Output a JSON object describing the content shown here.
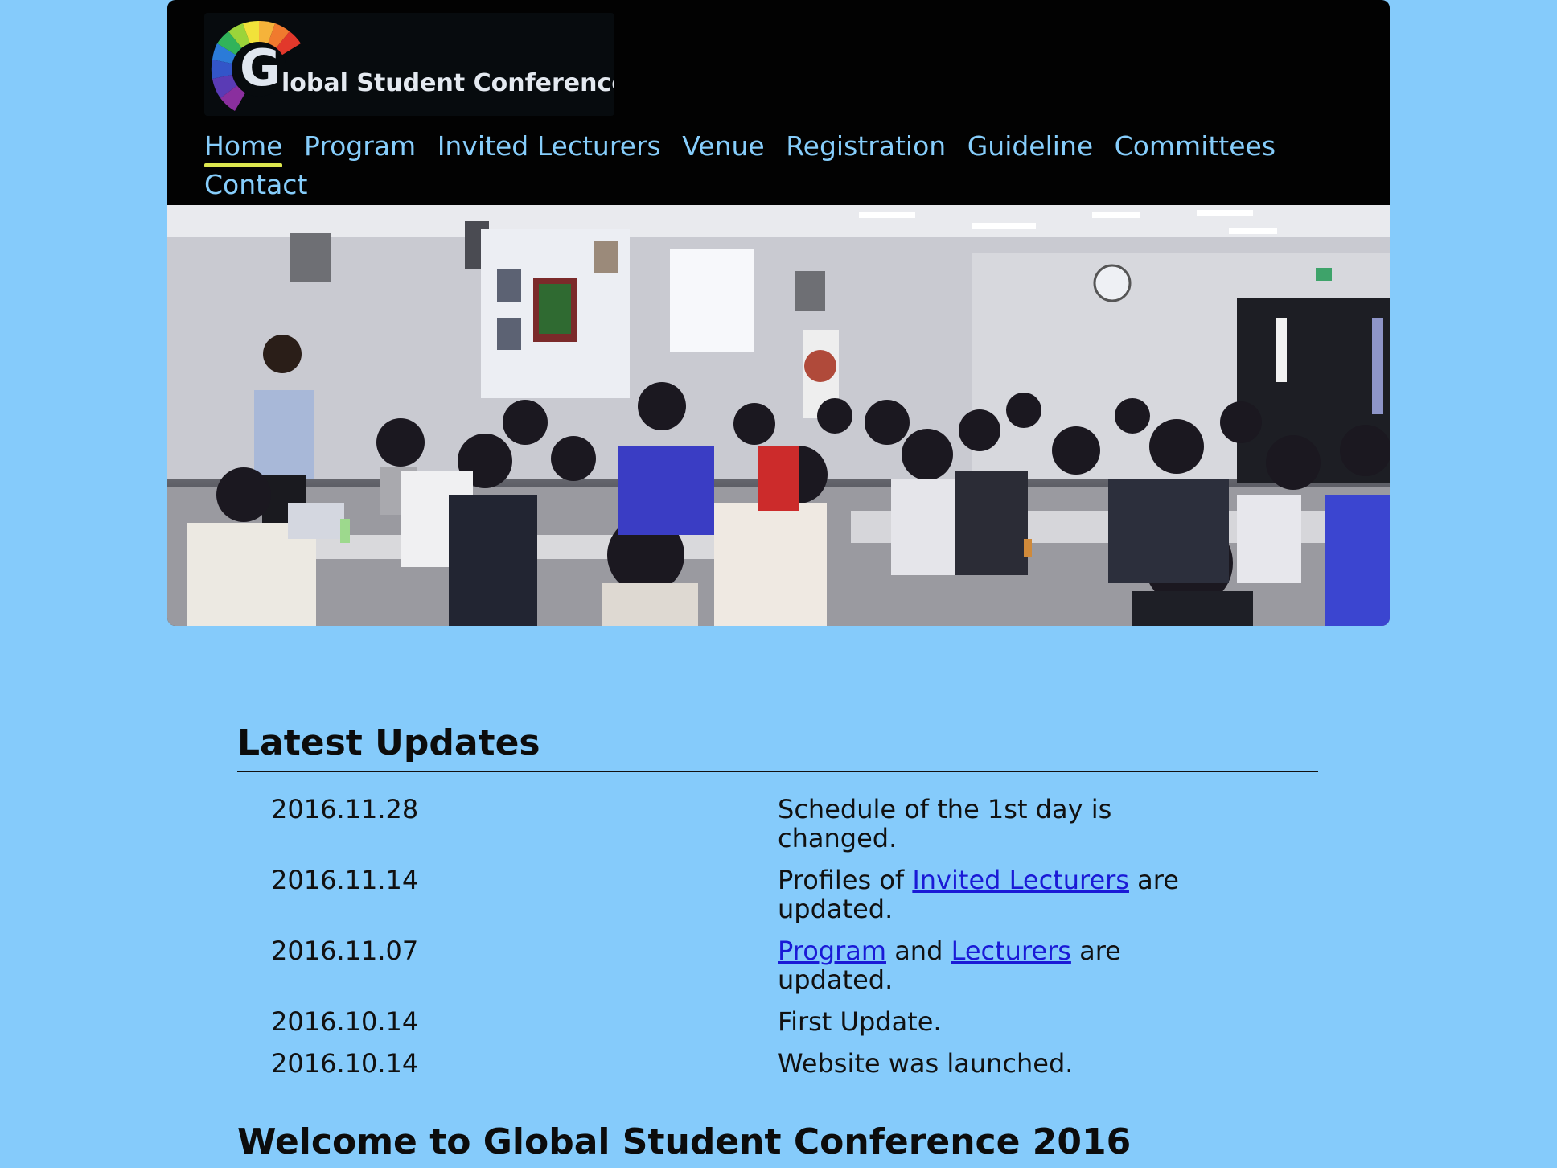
{
  "header": {
    "logo_letter": "G",
    "logo_text": "lobal Student Conference",
    "nav": [
      {
        "label": "Home",
        "active": true
      },
      {
        "label": "Program",
        "active": false
      },
      {
        "label": "Invited Lecturers",
        "active": false
      },
      {
        "label": "Venue",
        "active": false
      },
      {
        "label": "Registration",
        "active": false
      },
      {
        "label": "Guideline",
        "active": false
      },
      {
        "label": "Committees",
        "active": false
      },
      {
        "label": "Contact",
        "active": false
      }
    ]
  },
  "updates": {
    "title": "Latest Updates",
    "rows": [
      {
        "date": "2016.11.28",
        "text": "Schedule of the 1st day is changed."
      },
      {
        "date": "2016.11.14",
        "pre": "Profiles of ",
        "link1": "Invited Lecturers",
        "post": " are updated."
      },
      {
        "date": "2016.11.07",
        "link1": "Program",
        "mid": " and ",
        "link2": "Lecturers",
        "post": " are updated."
      },
      {
        "date": "2016.10.14",
        "text": "First Update."
      },
      {
        "date": "2016.10.14",
        "text": "Website was launched."
      }
    ]
  },
  "welcome": {
    "title": "Welcome to Global Student Conference 2016"
  },
  "colors": {
    "background": "#85cbfb",
    "header": "#020202",
    "nav_link": "#86cdfb",
    "active_underline": "#dde74e",
    "link": "#1a1ad6"
  }
}
